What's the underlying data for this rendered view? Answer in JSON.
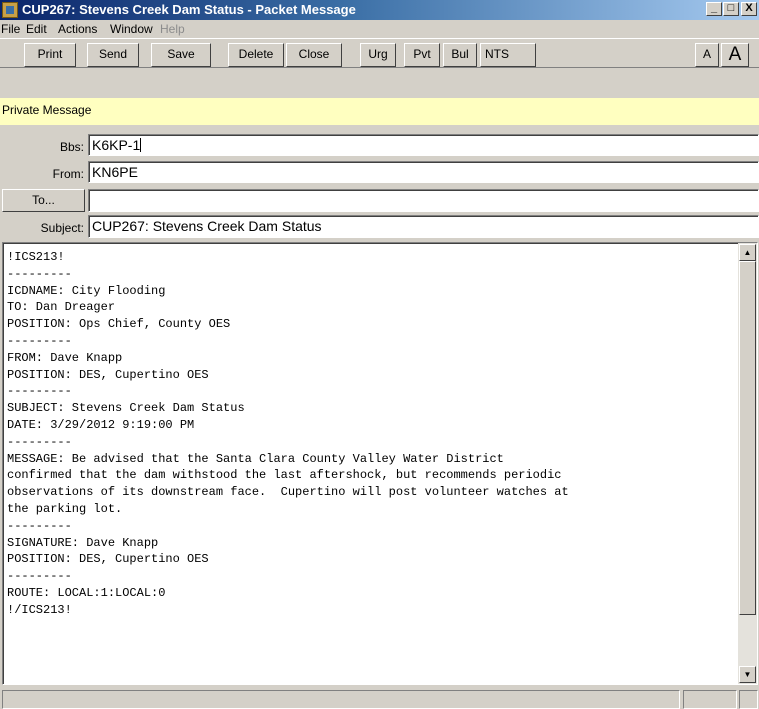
{
  "window": {
    "title": "CUP267: Stevens Creek Dam Status - Packet Message",
    "controls": {
      "minimize": "_",
      "maximize": "□",
      "close": "X"
    }
  },
  "menu": [
    {
      "label": "File",
      "enabled": true
    },
    {
      "label": "Edit",
      "enabled": true
    },
    {
      "label": "Actions",
      "enabled": true
    },
    {
      "label": "Window",
      "enabled": true
    },
    {
      "label": "Help",
      "enabled": false
    }
  ],
  "toolbar": {
    "print": "Print",
    "send": "Send",
    "save": "Save",
    "delete": "Delete",
    "close": "Close",
    "urg": "Urg",
    "pvt": "Pvt",
    "bul": "Bul",
    "nts": "NTS",
    "font_small": "A",
    "font_large": "A"
  },
  "banner": {
    "text": "Private Message",
    "color": "#ffffc0"
  },
  "form": {
    "bbs_label": "Bbs:",
    "bbs_value": "K6KP-1",
    "from_label": "From:",
    "from_value": "KN6PE",
    "to_button": "To...",
    "to_value": "",
    "subject_label": "Subject:",
    "subject_value": "CUP267: Stevens Creek Dam Status"
  },
  "message_body": "!ICS213!\n---------\nICDNAME: City Flooding\nTO: Dan Dreager\nPOSITION: Ops Chief, County OES\n---------\nFROM: Dave Knapp\nPOSITION: DES, Cupertino OES\n---------\nSUBJECT: Stevens Creek Dam Status\nDATE: 3/29/2012 9:19:00 PM\n---------\nMESSAGE: Be advised that the Santa Clara County Valley Water District\nconfirmed that the dam withstood the last aftershock, but recommends periodic\nobservations of its downstream face.  Cupertino will post volunteer watches at\nthe parking lot.\n---------\nSIGNATURE: Dave Knapp\nPOSITION: DES, Cupertino OES\n---------\nROUTE: LOCAL:1:LOCAL:0\n!/ICS213!",
  "colors": {
    "title_start": "#0a246a",
    "title_end": "#a6caf0",
    "face": "#d4d0c8"
  }
}
